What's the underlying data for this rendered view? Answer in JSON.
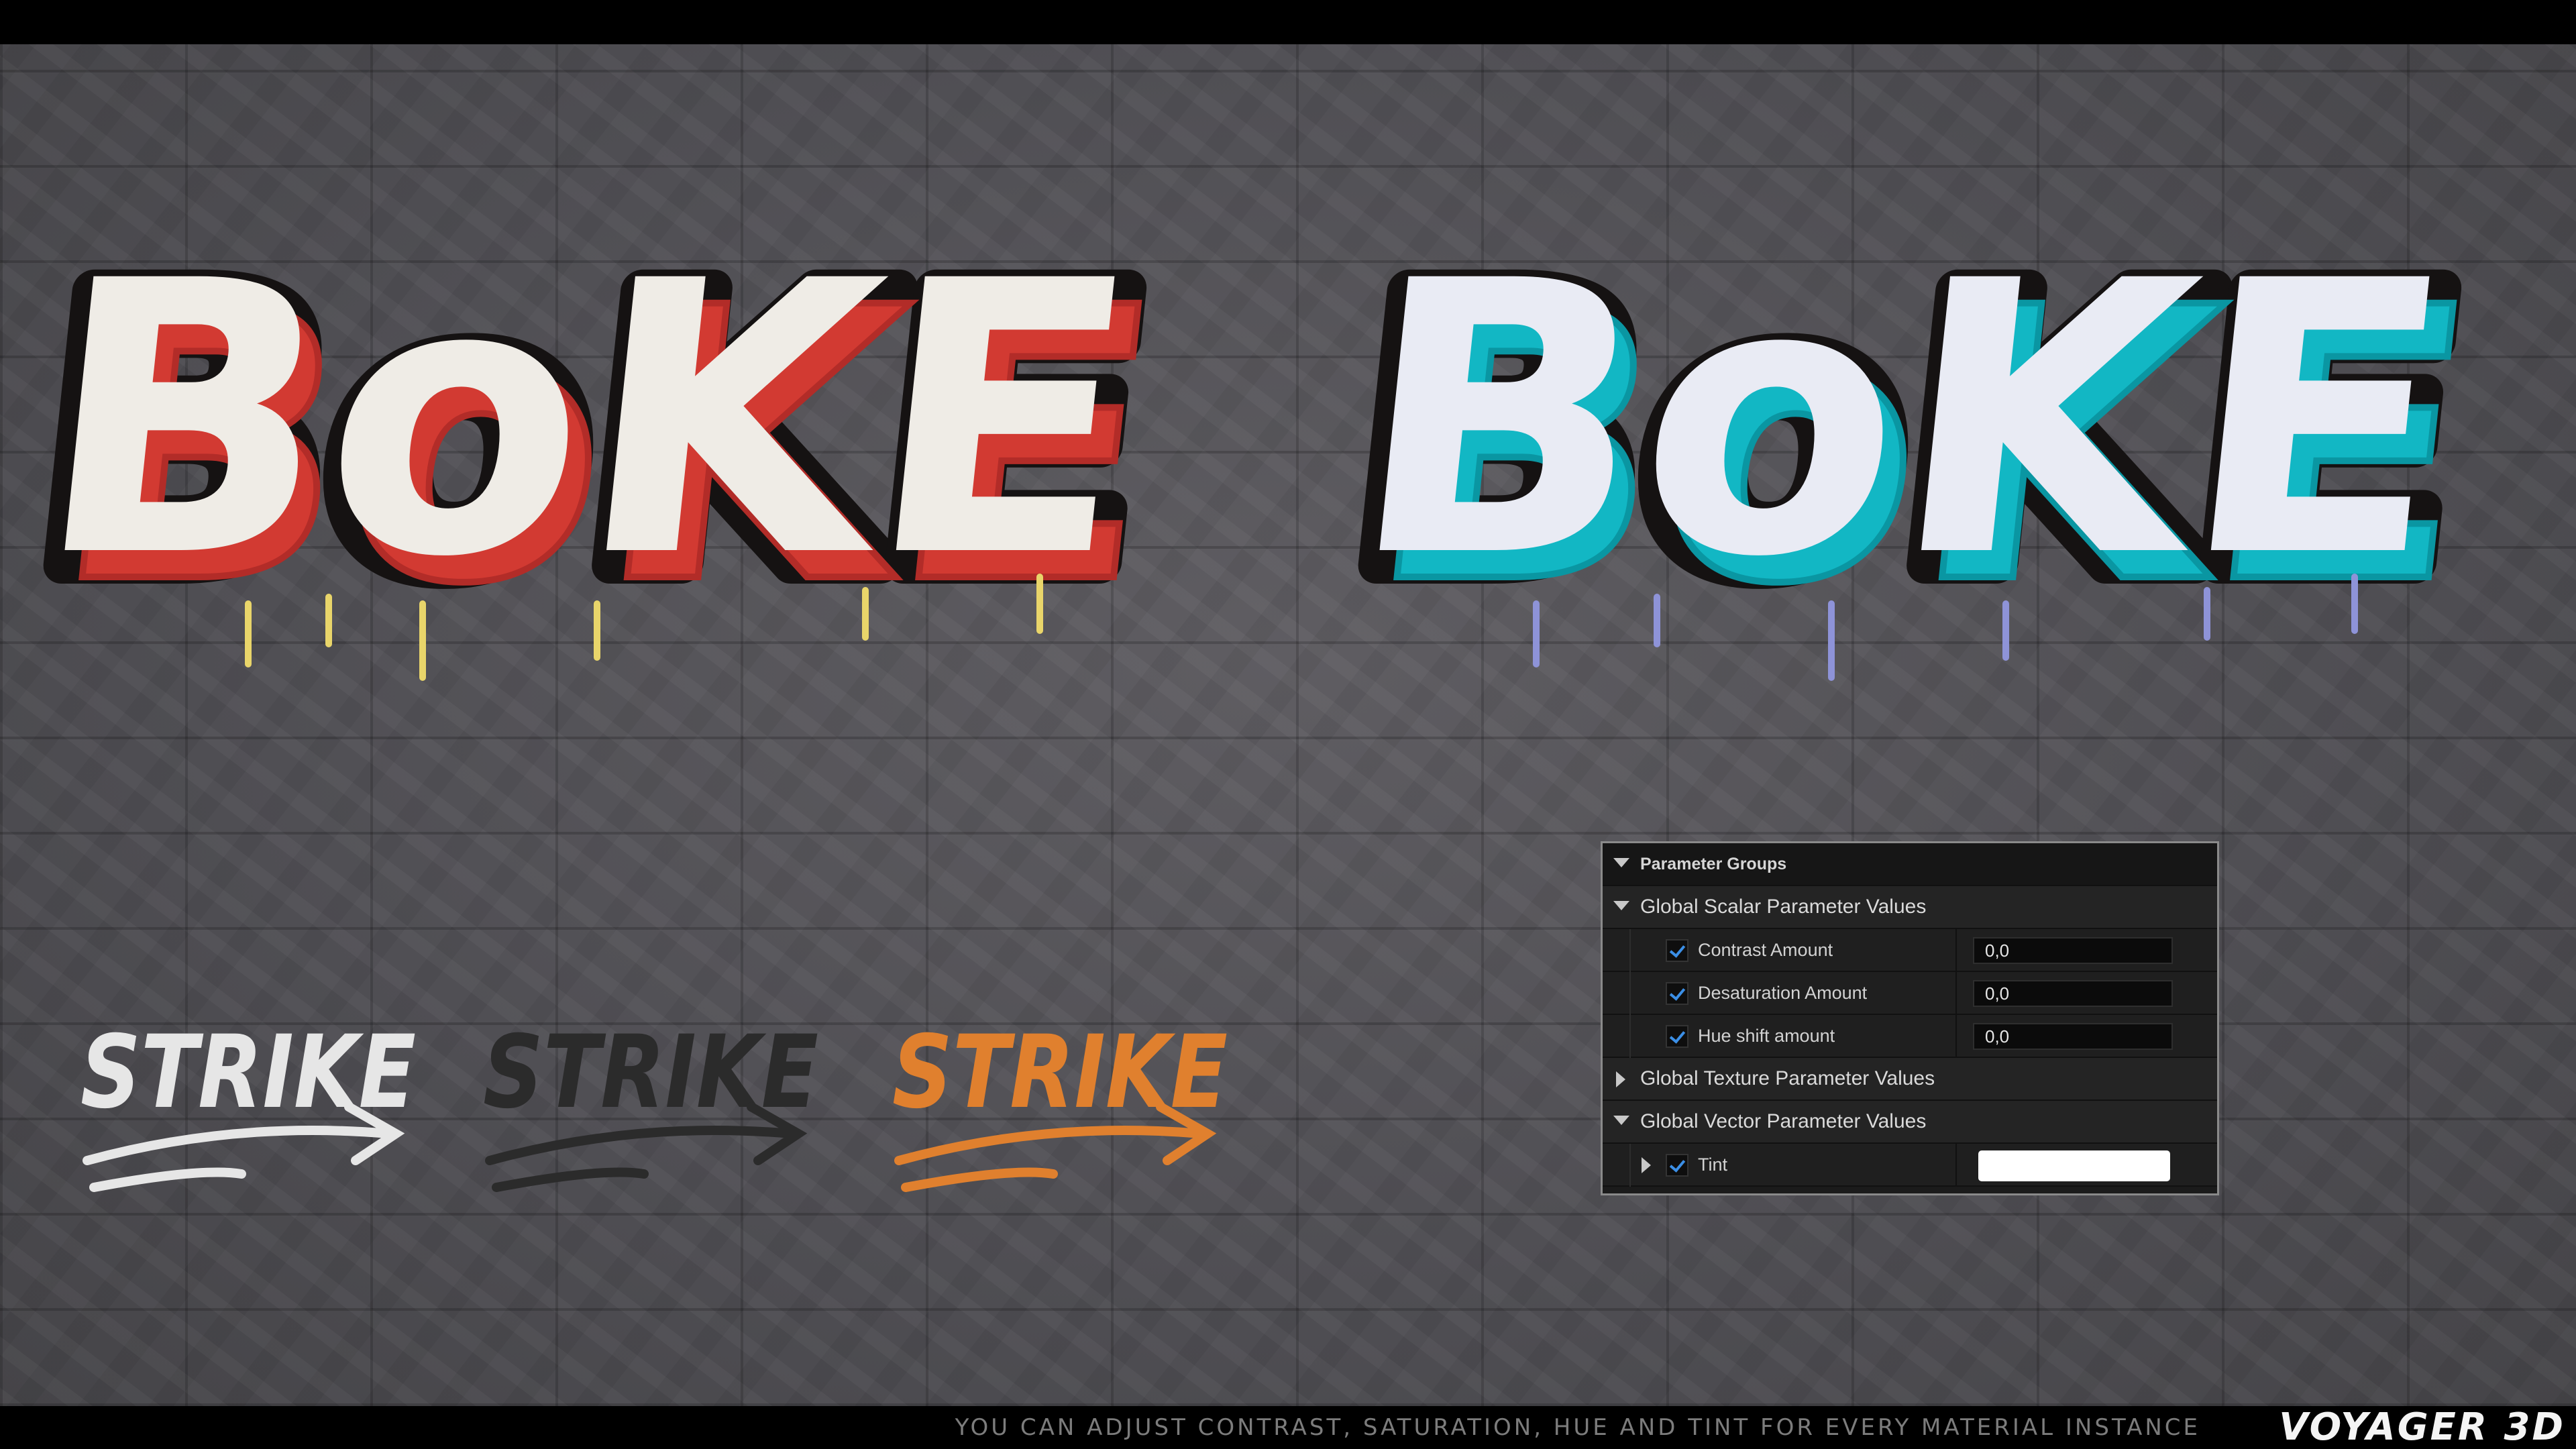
{
  "graffiti": {
    "left_word": "BoKE",
    "right_word": "BoKE",
    "tag_word": "STRIKE",
    "left_fill": "#efece6",
    "left_shadow": "#d23a32",
    "right_fill": "#e9ebf4",
    "right_shadow": "#12b7c4",
    "tag_colors": [
      "#e6e6e6",
      "#2b2b2b",
      "#e0802e"
    ]
  },
  "panel": {
    "header": "Parameter Groups",
    "scalar_group": "Global Scalar Parameter Values",
    "scalar_params": [
      {
        "label": "Contrast Amount",
        "value": "0,0"
      },
      {
        "label": "Desaturation Amount",
        "value": "0,0"
      },
      {
        "label": "Hue shift amount",
        "value": "0,0"
      }
    ],
    "texture_group": "Global Texture Parameter Values",
    "vector_group": "Global Vector Parameter Values",
    "tint": {
      "label": "Tint",
      "color": "#ffffff"
    }
  },
  "footer": {
    "caption": "YOU CAN ADJUST CONTRAST, SATURATION, HUE AND TINT FOR EVERY MATERIAL INSTANCE",
    "brand": "VOYAGER 3D"
  }
}
